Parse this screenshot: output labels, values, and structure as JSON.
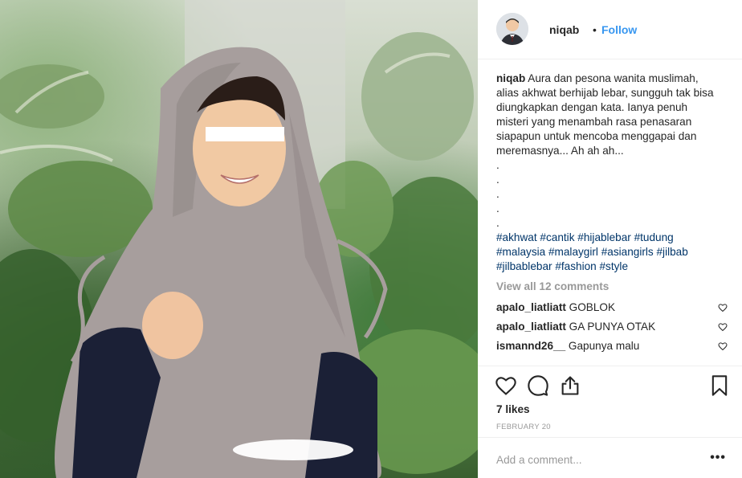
{
  "post": {
    "username": "niqab",
    "dot": "•",
    "follow_label": "Follow"
  },
  "caption": {
    "username": "niqab",
    "lines": [
      "Aura dan pesona wanita muslimah,",
      "alias akhwat berhijab lebar, sungguh tak bisa",
      "diungkapkan dengan kata. Ianya penuh",
      "misteri yang menambah rasa penasaran",
      "siapapun untuk mencoba menggapai dan",
      "meremasnya... Ah ah ah...",
      ".",
      ".",
      ".",
      ".",
      "."
    ],
    "hashtag_lines": [
      [
        "#akhwat",
        "#cantik",
        "#hijablebar",
        "#tudung"
      ],
      [
        "#malaysia",
        "#malaygirl",
        "#asiangirls",
        "#jilbab"
      ],
      [
        "#jilbablebar",
        "#fashion",
        "#style"
      ]
    ]
  },
  "view_all_comments": "View all 12 comments",
  "comments": [
    {
      "user": "apalo_liatliatt",
      "text": "GOBLOK"
    },
    {
      "user": "apalo_liatliatt",
      "text": "GA PUNYA OTAK"
    },
    {
      "user": "ismannd26__",
      "text": "Gapunya malu"
    }
  ],
  "likes": "7 likes",
  "date": "FEBRUARY 20",
  "add_comment_placeholder": "Add a comment...",
  "more_label": "•••",
  "icons": {
    "like": "heart-icon",
    "comment": "comment-icon",
    "share": "share-icon",
    "save": "bookmark-icon",
    "comment_like": "heart-icon"
  },
  "colors": {
    "link": "#3897f0",
    "hashtag": "#003569",
    "muted": "#999999",
    "hijab": "#a79e9d",
    "navy_shirt": "#1b2036"
  }
}
